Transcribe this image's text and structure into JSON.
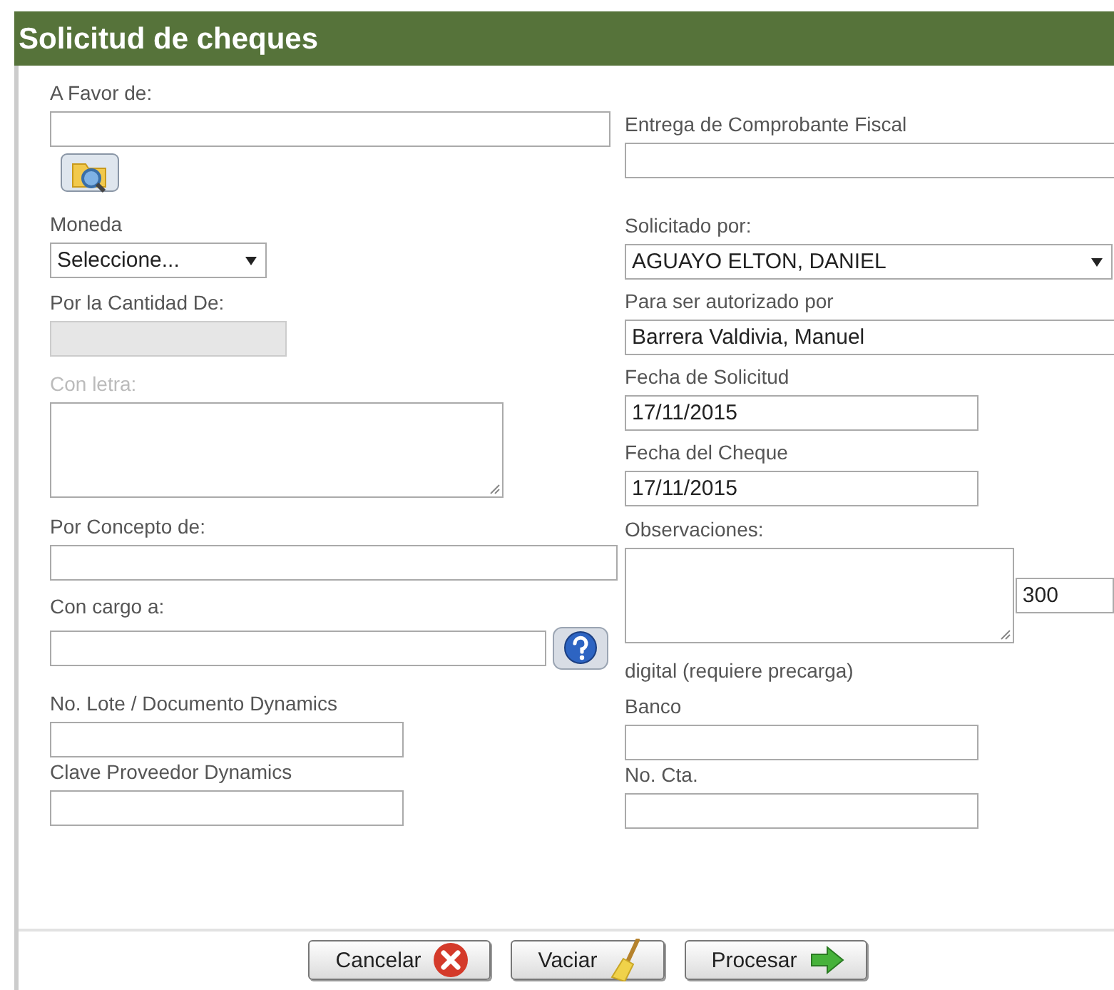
{
  "window": {
    "title": "Solicitud de cheques"
  },
  "left_fields": [
    {
      "kind": "text",
      "label": "A Favor de:",
      "disabled": false,
      "dimmed": false
    },
    {
      "kind": "lookup_button",
      "disabled": false,
      "dimmed": false
    },
    {
      "kind": "select",
      "label": "Moneda",
      "value": "Seleccione...",
      "disabled": false,
      "dimmed": false
    },
    {
      "kind": "text",
      "label": "Por la Cantidad De:",
      "disabled": true,
      "dimmed": false
    },
    {
      "kind": "textarea",
      "label": "Con letra:",
      "disabled": false,
      "dimmed": true
    },
    {
      "kind": "text",
      "label": "Por Concepto de:",
      "disabled": false,
      "dimmed": false
    },
    {
      "kind": "text_help",
      "label": "Con cargo a:",
      "disabled": false,
      "dimmed": false
    },
    {
      "kind": "text",
      "label": "No. Lote / Documento Dynamics",
      "disabled": false,
      "dimmed": false
    },
    {
      "kind": "text",
      "label": "Clave Proveedor Dynamics",
      "disabled": false,
      "dimmed": false
    }
  ],
  "right_fields": [
    {
      "kind": "text",
      "label": "Entrega de Comprobante Fiscal"
    },
    {
      "kind": "select",
      "label": "Solicitado por:",
      "value": "AGUAYO ELTON, DANIEL"
    },
    {
      "kind": "text",
      "label": "Para ser autorizado por",
      "value": "Barrera Valdivia, Manuel"
    },
    {
      "kind": "text",
      "label": "Fecha de Solicitud",
      "value": "17/11/2015"
    },
    {
      "kind": "text",
      "label": "Fecha del Cheque",
      "value": "17/11/2015"
    },
    {
      "kind": "textarea_counter",
      "label": "Observaciones:",
      "counter": "300"
    },
    {
      "kind": "note",
      "label": "digital (requiere precarga)"
    },
    {
      "kind": "text",
      "label": "Banco"
    },
    {
      "kind": "text",
      "label": "No. Cta."
    }
  ],
  "buttons": [
    {
      "kind": "cancel",
      "label": "Cancelar"
    },
    {
      "kind": "clear",
      "label": "Vaciar"
    },
    {
      "kind": "process",
      "label": "Procesar"
    }
  ]
}
